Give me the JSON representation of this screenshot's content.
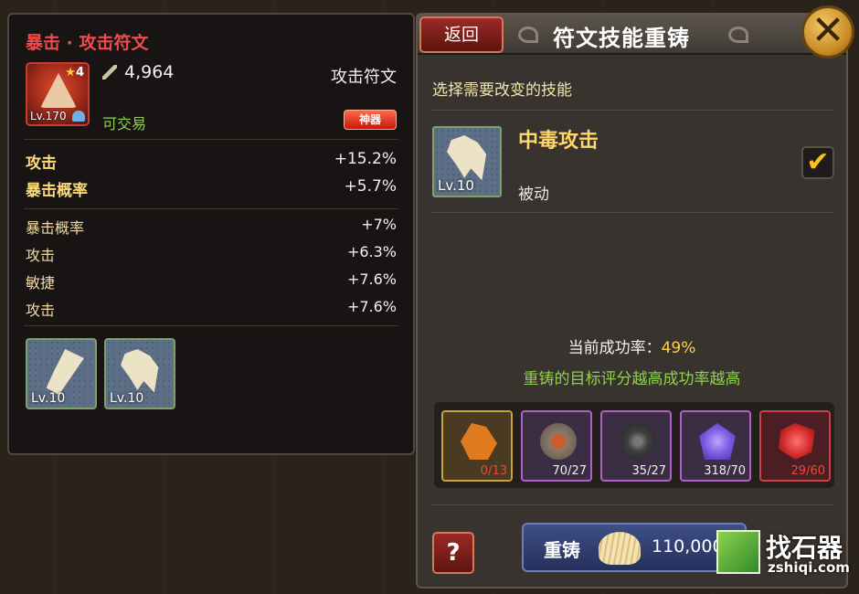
{
  "left_panel": {
    "title": "暴击 · 攻击符文",
    "item": {
      "star": "4",
      "level": "Lv.170"
    },
    "power": "4,964",
    "rune_type": "攻击符文",
    "tradable": "可交易",
    "badge": "神器",
    "main_stats": [
      {
        "name": "攻击",
        "value": "+15.2%"
      },
      {
        "name": "暴击概率",
        "value": "+5.7%"
      }
    ],
    "sub_stats": [
      {
        "name": "暴击概率",
        "value": "+7%"
      },
      {
        "name": "攻击",
        "value": "+6.3%"
      },
      {
        "name": "敏捷",
        "value": "+7.6%"
      },
      {
        "name": "攻击",
        "value": "+7.6%"
      }
    ],
    "skills": [
      {
        "level": "Lv.10",
        "icon": "quill-rune-icon"
      },
      {
        "level": "Lv.10",
        "icon": "claw-rune-icon"
      }
    ]
  },
  "right_panel": {
    "back_label": "返回",
    "title": "符文技能重铸",
    "close_label": "✕",
    "instruction": "选择需要改变的技能",
    "skill": {
      "name": "中毒攻击",
      "type": "被动",
      "level": "Lv.10",
      "checked": "✔"
    },
    "rate_label": "当前成功率：",
    "rate_value": "49%",
    "tip": "重铸的目标评分越高成功率越高",
    "materials": [
      {
        "count": "0/13",
        "icon": "fire-crystal-icon",
        "color": "#e07a1f",
        "frame": "#c9a23a"
      },
      {
        "count": "70/27",
        "icon": "ember-stone-icon",
        "color": "#8a7a6a",
        "frame": "#b061c6"
      },
      {
        "count": "35/27",
        "icon": "dark-stone-icon",
        "color": "#4a4a4a",
        "frame": "#b061c6"
      },
      {
        "count": "318/70",
        "icon": "purple-gem-icon",
        "color": "#7a5ae0",
        "frame": "#b061c6"
      },
      {
        "count": "29/60",
        "icon": "red-gem-icon",
        "color": "#d02a2a",
        "frame": "#c9424a"
      }
    ],
    "help_label": "?",
    "reforge_label": "重铸",
    "cost": "110,000"
  },
  "watermark": {
    "text": "找石器",
    "url": "zshiqi.com"
  }
}
